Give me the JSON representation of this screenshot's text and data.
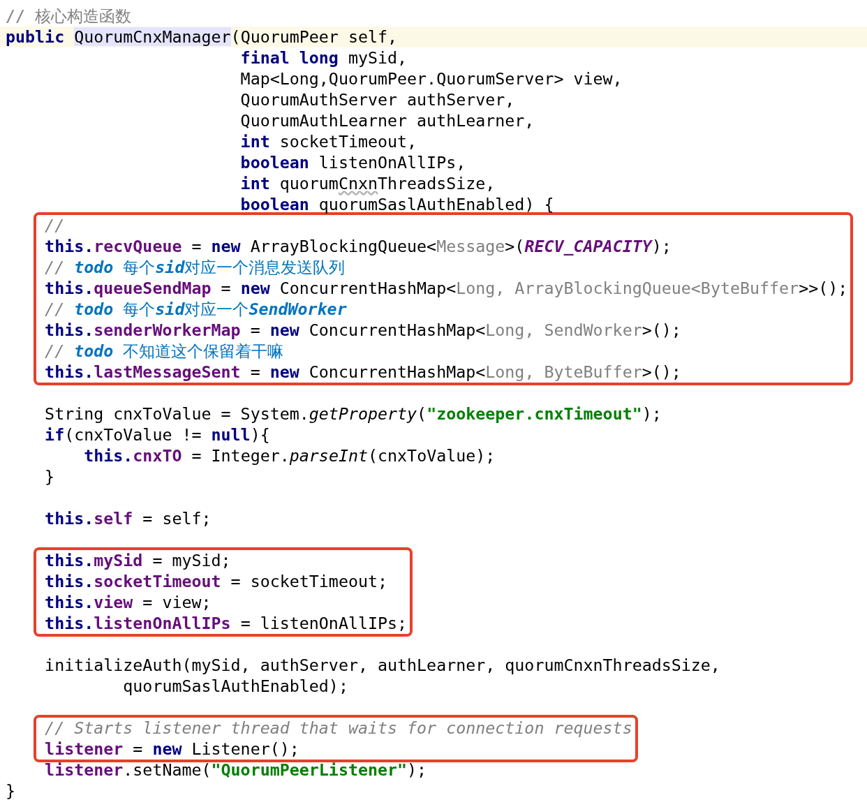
{
  "editor": {
    "sections": [
      {
        "groups": [
          {
            "kind": "plain",
            "lines": [
              {
                "current": false,
                "tokens": [
                  {
                    "text": "// 核心构造函数",
                    "kind": "comment_plain"
                  }
                ]
              },
              {
                "current": true,
                "tokens": [
                  {
                    "text": "public ",
                    "kind": "keyword"
                  },
                  {
                    "text": "QuorumCnxManager",
                    "kind": "match"
                  },
                  {
                    "text": "(QuorumPeer self,",
                    "kind": "plain"
                  }
                ]
              },
              {
                "current": false,
                "tokens": [
                  {
                    "text": "                        final long",
                    "kind": "keyword"
                  },
                  {
                    "text": " mySid,",
                    "kind": "plain"
                  }
                ]
              },
              {
                "current": false,
                "tokens": [
                  {
                    "text": "                        Map<Long,QuorumPeer.QuorumServer> view,",
                    "kind": "plain"
                  }
                ]
              },
              {
                "current": false,
                "tokens": [
                  {
                    "text": "                        QuorumAuthServer authServer,",
                    "kind": "plain"
                  }
                ]
              },
              {
                "current": false,
                "tokens": [
                  {
                    "text": "                        QuorumAuthLearner authLearner,",
                    "kind": "plain"
                  }
                ]
              },
              {
                "current": false,
                "tokens": [
                  {
                    "text": "                        int",
                    "kind": "keyword"
                  },
                  {
                    "text": " socketTimeout,",
                    "kind": "plain"
                  }
                ]
              },
              {
                "current": false,
                "tokens": [
                  {
                    "text": "                        boolean",
                    "kind": "keyword"
                  },
                  {
                    "text": " listenOnAllIPs,",
                    "kind": "plain"
                  }
                ]
              },
              {
                "current": false,
                "tokens": [
                  {
                    "text": "                        int",
                    "kind": "keyword"
                  },
                  {
                    "text": " quorum",
                    "kind": "plain"
                  },
                  {
                    "text": "Cnxn",
                    "kind": "typo"
                  },
                  {
                    "text": "ThreadsSize,",
                    "kind": "plain"
                  }
                ]
              },
              {
                "current": false,
                "tokens": [
                  {
                    "text": "                        boolean",
                    "kind": "keyword"
                  },
                  {
                    "text": " quorumSaslAuthEnabled) {",
                    "kind": "plain"
                  }
                ]
              }
            ]
          },
          {
            "kind": "boxed",
            "lines": [
              {
                "current": false,
                "tokens": [
                  {
                    "text": "    //",
                    "kind": "comment"
                  }
                ]
              },
              {
                "current": false,
                "tokens": [
                  {
                    "text": "    this.",
                    "kind": "keyword"
                  },
                  {
                    "text": "recvQueue",
                    "kind": "field"
                  },
                  {
                    "text": " = ",
                    "kind": "plain"
                  },
                  {
                    "text": "new",
                    "kind": "keyword"
                  },
                  {
                    "text": " ArrayBlockingQueue<",
                    "kind": "plain"
                  },
                  {
                    "text": "Message",
                    "kind": "generic"
                  },
                  {
                    "text": ">(",
                    "kind": "plain"
                  },
                  {
                    "text": "RECV_CAPACITY",
                    "kind": "constant"
                  },
                  {
                    "text": ");",
                    "kind": "plain"
                  }
                ]
              },
              {
                "current": false,
                "tokens": [
                  {
                    "text": "    // ",
                    "kind": "comment"
                  },
                  {
                    "text": "todo",
                    "kind": "todo_bold"
                  },
                  {
                    "text": " 每个",
                    "kind": "todo"
                  },
                  {
                    "text": "sid",
                    "kind": "todo_bold"
                  },
                  {
                    "text": "对应一个消息发送队列",
                    "kind": "todo"
                  }
                ]
              },
              {
                "current": false,
                "tokens": [
                  {
                    "text": "    this.",
                    "kind": "keyword"
                  },
                  {
                    "text": "queueSendMap",
                    "kind": "field"
                  },
                  {
                    "text": " = ",
                    "kind": "plain"
                  },
                  {
                    "text": "new",
                    "kind": "keyword"
                  },
                  {
                    "text": " ConcurrentHashMap<",
                    "kind": "plain"
                  },
                  {
                    "text": "Long, ArrayBlockingQueue<ByteBuffer",
                    "kind": "generic"
                  },
                  {
                    "text": ">>();",
                    "kind": "plain"
                  }
                ]
              },
              {
                "current": false,
                "tokens": [
                  {
                    "text": "    // ",
                    "kind": "comment"
                  },
                  {
                    "text": "todo",
                    "kind": "todo_bold"
                  },
                  {
                    "text": " 每个",
                    "kind": "todo"
                  },
                  {
                    "text": "sid",
                    "kind": "todo_bold"
                  },
                  {
                    "text": "对应一个",
                    "kind": "todo"
                  },
                  {
                    "text": "SendWorker",
                    "kind": "todo_bold"
                  }
                ]
              },
              {
                "current": false,
                "tokens": [
                  {
                    "text": "    this.",
                    "kind": "keyword"
                  },
                  {
                    "text": "senderWorkerMap",
                    "kind": "field"
                  },
                  {
                    "text": " = ",
                    "kind": "plain"
                  },
                  {
                    "text": "new",
                    "kind": "keyword"
                  },
                  {
                    "text": " ConcurrentHashMap<",
                    "kind": "plain"
                  },
                  {
                    "text": "Long, SendWorker",
                    "kind": "generic"
                  },
                  {
                    "text": ">();",
                    "kind": "plain"
                  }
                ]
              },
              {
                "current": false,
                "tokens": [
                  {
                    "text": "    // ",
                    "kind": "comment"
                  },
                  {
                    "text": "todo",
                    "kind": "todo_bold"
                  },
                  {
                    "text": " 不知道这个保留着干嘛",
                    "kind": "todo"
                  }
                ]
              },
              {
                "current": false,
                "tokens": [
                  {
                    "text": "    this.",
                    "kind": "keyword"
                  },
                  {
                    "text": "lastMessageSent",
                    "kind": "field"
                  },
                  {
                    "text": " = ",
                    "kind": "plain"
                  },
                  {
                    "text": "new",
                    "kind": "keyword"
                  },
                  {
                    "text": " ConcurrentHashMap<",
                    "kind": "plain"
                  },
                  {
                    "text": "Long, ByteBuffer",
                    "kind": "generic"
                  },
                  {
                    "text": ">();",
                    "kind": "plain"
                  }
                ]
              }
            ]
          }
        ]
      },
      {
        "groups": [
          {
            "kind": "plain",
            "lines": [
              {
                "current": false,
                "tokens": [
                  {
                    "text": "    String cnxToValue = System.",
                    "kind": "plain"
                  },
                  {
                    "text": "getProperty",
                    "kind": "static_method"
                  },
                  {
                    "text": "(",
                    "kind": "plain"
                  },
                  {
                    "text": "\"zookeeper.cnxTimeout\"",
                    "kind": "string"
                  },
                  {
                    "text": ");",
                    "kind": "plain"
                  }
                ]
              },
              {
                "current": false,
                "tokens": [
                  {
                    "text": "    if",
                    "kind": "keyword"
                  },
                  {
                    "text": "(cnxToValue != ",
                    "kind": "plain"
                  },
                  {
                    "text": "null",
                    "kind": "keyword"
                  },
                  {
                    "text": "){",
                    "kind": "plain"
                  }
                ]
              },
              {
                "current": false,
                "tokens": [
                  {
                    "text": "        this.",
                    "kind": "keyword"
                  },
                  {
                    "text": "cnxTO",
                    "kind": "field"
                  },
                  {
                    "text": " = Integer.",
                    "kind": "plain"
                  },
                  {
                    "text": "parseInt",
                    "kind": "static_method"
                  },
                  {
                    "text": "(cnxToValue);",
                    "kind": "plain"
                  }
                ]
              },
              {
                "current": false,
                "tokens": [
                  {
                    "text": "    }",
                    "kind": "plain"
                  }
                ]
              }
            ]
          }
        ]
      },
      {
        "groups": [
          {
            "kind": "plain",
            "lines": [
              {
                "current": false,
                "tokens": [
                  {
                    "text": "    this.",
                    "kind": "keyword"
                  },
                  {
                    "text": "self",
                    "kind": "field"
                  },
                  {
                    "text": " = self;",
                    "kind": "plain"
                  }
                ]
              }
            ]
          }
        ]
      },
      {
        "groups": [
          {
            "kind": "boxed",
            "lines": [
              {
                "current": false,
                "tokens": [
                  {
                    "text": "    this.",
                    "kind": "keyword"
                  },
                  {
                    "text": "mySid",
                    "kind": "field"
                  },
                  {
                    "text": " = mySid;",
                    "kind": "plain"
                  }
                ]
              },
              {
                "current": false,
                "tokens": [
                  {
                    "text": "    this.",
                    "kind": "keyword"
                  },
                  {
                    "text": "socketTimeout",
                    "kind": "field"
                  },
                  {
                    "text": " = socketTimeout;",
                    "kind": "plain"
                  }
                ]
              },
              {
                "current": false,
                "tokens": [
                  {
                    "text": "    this.",
                    "kind": "keyword"
                  },
                  {
                    "text": "view",
                    "kind": "field"
                  },
                  {
                    "text": " = view;",
                    "kind": "plain"
                  }
                ]
              },
              {
                "current": false,
                "tokens": [
                  {
                    "text": "    this.",
                    "kind": "keyword"
                  },
                  {
                    "text": "listenOnAllIPs",
                    "kind": "field"
                  },
                  {
                    "text": " = listenOnAllIPs;",
                    "kind": "plain"
                  }
                ]
              }
            ]
          }
        ]
      },
      {
        "groups": [
          {
            "kind": "plain",
            "lines": [
              {
                "current": false,
                "tokens": [
                  {
                    "text": "    initializeAuth(mySid, authServer, authLearner, quorumCnxnThreadsSize,",
                    "kind": "plain"
                  }
                ]
              },
              {
                "current": false,
                "tokens": [
                  {
                    "text": "            quorumSaslAuthEnabled);",
                    "kind": "plain"
                  }
                ]
              }
            ]
          }
        ]
      },
      {
        "groups": [
          {
            "kind": "boxed",
            "lines": [
              {
                "current": false,
                "tokens": [
                  {
                    "text": "    // Starts listener thread that waits for connection requests",
                    "kind": "comment"
                  }
                ]
              },
              {
                "current": false,
                "tokens": [
                  {
                    "text": "    listener",
                    "kind": "field"
                  },
                  {
                    "text": " = ",
                    "kind": "plain"
                  },
                  {
                    "text": "new",
                    "kind": "keyword"
                  },
                  {
                    "text": " Listener();",
                    "kind": "plain"
                  }
                ]
              }
            ]
          },
          {
            "kind": "plain",
            "lines": [
              {
                "current": false,
                "tokens": [
                  {
                    "text": "    listener",
                    "kind": "field"
                  },
                  {
                    "text": ".setName(",
                    "kind": "plain"
                  },
                  {
                    "text": "\"QuorumPeerListener\"",
                    "kind": "string"
                  },
                  {
                    "text": ");",
                    "kind": "plain"
                  }
                ]
              },
              {
                "current": false,
                "tokens": [
                  {
                    "text": "}",
                    "kind": "plain"
                  }
                ]
              }
            ]
          }
        ]
      }
    ]
  }
}
